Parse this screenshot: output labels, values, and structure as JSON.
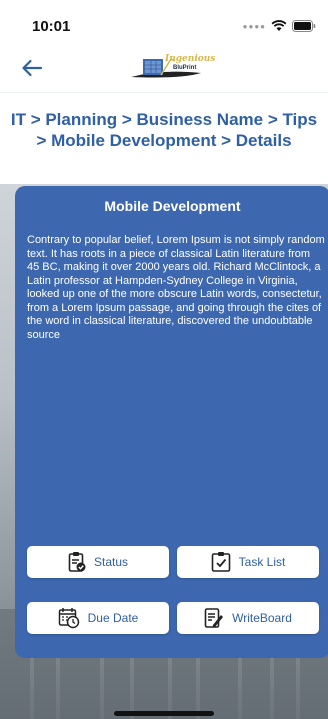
{
  "status_bar": {
    "time": "10:01"
  },
  "app": {
    "logo_line1": "Ingenious",
    "logo_line2": "BluPrint"
  },
  "breadcrumb": "IT > Planning > Business Name > Tips > Mobile Development > Details",
  "card": {
    "title": "Mobile Development",
    "body": "Contrary to popular belief, Lorem Ipsum is not simply random text. It has roots in a piece of classical Latin literature from 45 BC, making it over 2000 years old. Richard McClintock, a Latin professor at Hampden-Sydney College in Virginia, looked up one of the more obscure Latin words, consectetur, from a Lorem Ipsum passage, and going through the cites of the word in classical literature, discovered the undoubtable source"
  },
  "actions": {
    "status": {
      "label": "Status",
      "icon": "clipboard-check-icon"
    },
    "task_list": {
      "label": "Task List",
      "icon": "clipboard-list-icon"
    },
    "due_date": {
      "label": "Due Date",
      "icon": "calendar-clock-icon"
    },
    "writeboard": {
      "label": "WriteBoard",
      "icon": "notepad-pencil-icon"
    }
  },
  "colors": {
    "card_bg": "#3d68b0",
    "accent_text": "#2f5fa5"
  }
}
